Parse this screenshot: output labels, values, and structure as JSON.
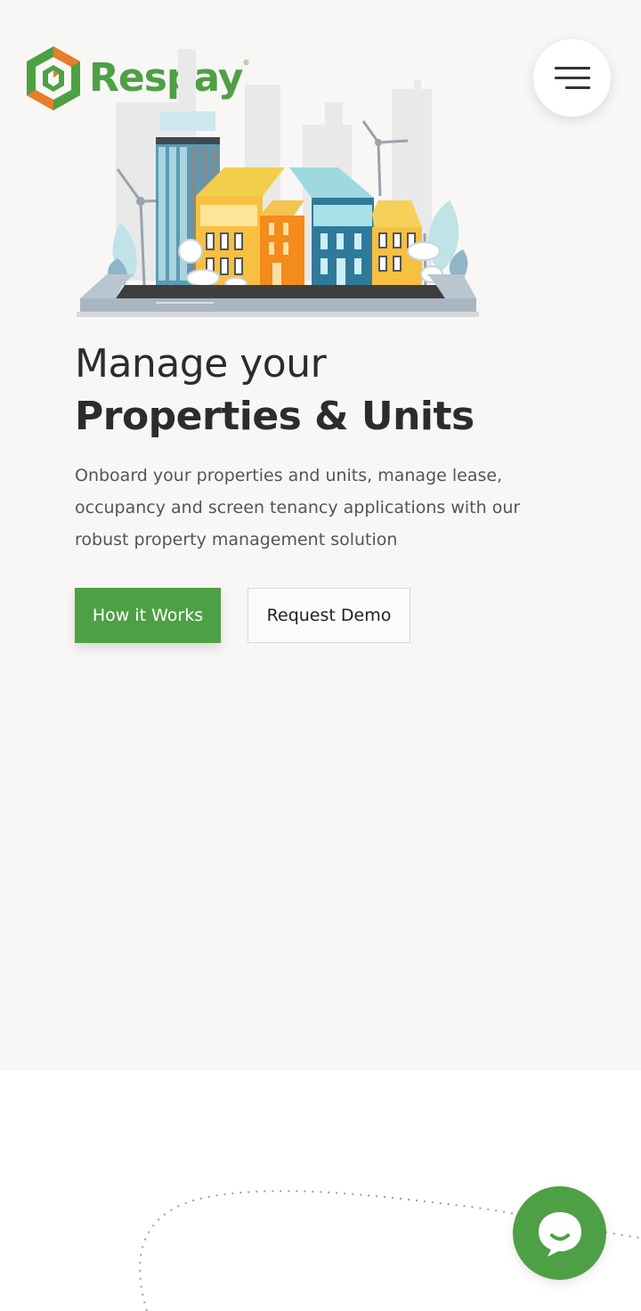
{
  "brand": {
    "name": "Respay",
    "tm": "®",
    "green": "#4ea044",
    "orange": "#e87d2c"
  },
  "header": {
    "menu_icon": "hamburger-menu-icon"
  },
  "hero": {
    "title_light": "Manage your",
    "title_bold": "Properties & Units",
    "description": "Onboard your properties and units, manage lease, occupancy and screen tenancy applications with our robust property management solution",
    "primary_cta": "How it Works",
    "secondary_cta": "Request Demo",
    "illustration_icon": "city-buildings-illustration"
  },
  "chat": {
    "icon": "chat-bubble-icon"
  }
}
